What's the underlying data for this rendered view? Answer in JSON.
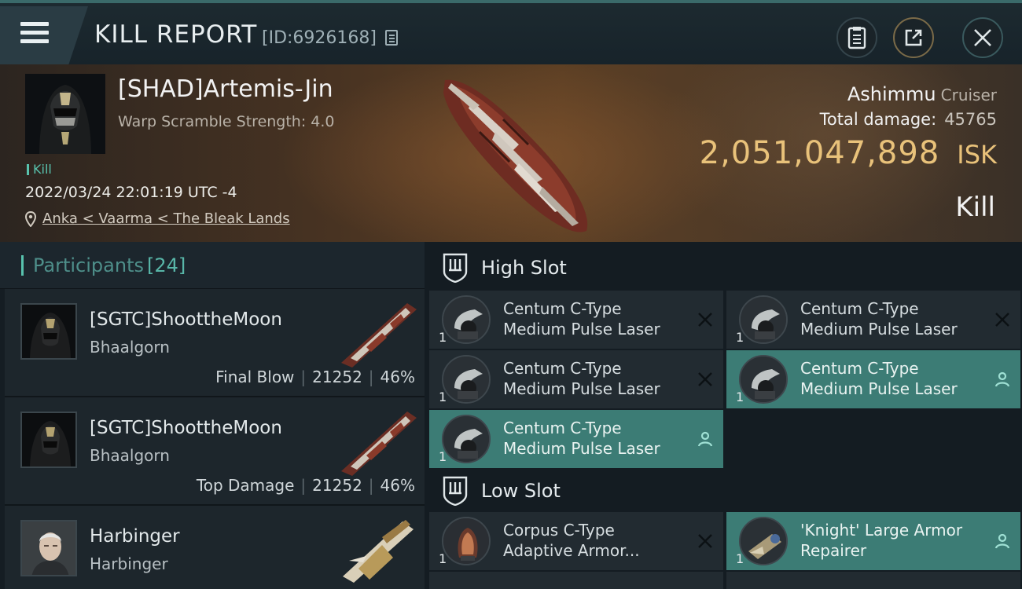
{
  "header": {
    "title": "KILL REPORT",
    "id_label": "[ID:6926168]"
  },
  "victim": {
    "name": "[SHAD]Artemis-Jin",
    "warp": "Warp Scramble Strength: 4.0",
    "tag": "Kill",
    "datetime": "2022/03/24 22:01:19 UTC -4",
    "location": "Anka < Vaarma < The Bleak Lands",
    "ship_name": "Ashimmu",
    "ship_class": "Cruiser",
    "total_damage_label": "Total damage:",
    "total_damage": "45765",
    "isk_value": "2,051,047,898",
    "isk_label": "ISK",
    "result": "Kill"
  },
  "participants": {
    "label": "Participants",
    "count": "[24]",
    "rows": [
      {
        "name": "[SGTC]ShoottheMoon",
        "ship": "Bhaalgorn",
        "role": "Final Blow",
        "damage": "21252",
        "percent": "46%"
      },
      {
        "name": "[SGTC]ShoottheMoon",
        "ship": "Bhaalgorn",
        "role": "Top Damage",
        "damage": "21252",
        "percent": "46%"
      },
      {
        "name": "Harbinger",
        "ship": "Harbinger",
        "role": "",
        "damage": "",
        "percent": ""
      }
    ]
  },
  "fitting": {
    "high_slot_label": "High Slot",
    "low_slot_label": "Low Slot",
    "high_modules": [
      {
        "line1": "Centum C-Type",
        "line2": "Medium Pulse Laser",
        "qty": "1",
        "status": "destroyed"
      },
      {
        "line1": "Centum C-Type",
        "line2": "Medium Pulse Laser",
        "qty": "1",
        "status": "destroyed"
      },
      {
        "line1": "Centum C-Type",
        "line2": "Medium Pulse Laser",
        "qty": "1",
        "status": "destroyed"
      },
      {
        "line1": "Centum C-Type",
        "line2": "Medium Pulse Laser",
        "qty": "1",
        "status": "dropped"
      },
      {
        "line1": "Centum C-Type",
        "line2": "Medium Pulse Laser",
        "qty": "1",
        "status": "dropped"
      }
    ],
    "low_modules": [
      {
        "line1": "Corpus C-Type",
        "line2": "Adaptive Armor...",
        "qty": "1",
        "status": "destroyed"
      },
      {
        "line1": "'Knight' Large Armor",
        "line2": "Repairer",
        "qty": "1",
        "status": "dropped"
      }
    ]
  },
  "colors": {
    "accent_teal": "#58c2ad",
    "isk_gold": "#e9c27a",
    "dropped_bg": "#3c7c75"
  }
}
